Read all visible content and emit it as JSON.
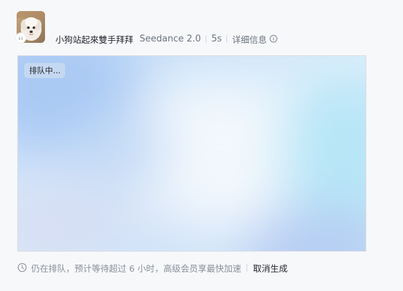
{
  "header": {
    "prompt": "小狗站起來雙手拜拜",
    "model": "Seedance 2.0",
    "duration": "5s",
    "details_label": "详细信息"
  },
  "preview": {
    "status": "排队中..."
  },
  "footer": {
    "queue_message": "仍在排队，预计等待超过 6 小时，高级会员享最快加速",
    "cancel_label": "取消生成"
  },
  "icons": {
    "avatar": "dog-avatar-image",
    "badge": "quote-icon",
    "details": "info-icon",
    "clock": "clock-icon"
  },
  "colors": {
    "page_background": "#f7f8fa",
    "preview_gradient_main": "#c9e1f7",
    "status_pill": "#c6d8f0",
    "muted_text": "#8a909a"
  }
}
